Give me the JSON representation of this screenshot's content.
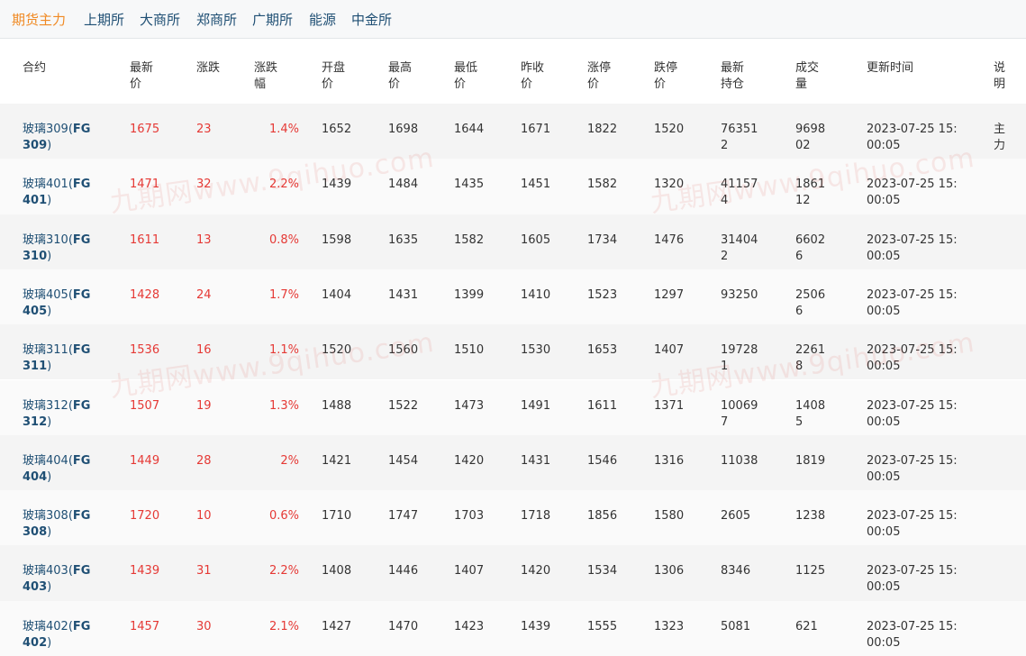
{
  "tabs": [
    {
      "label": "期货主力",
      "active": true
    },
    {
      "label": "上期所",
      "active": false
    },
    {
      "label": "大商所",
      "active": false
    },
    {
      "label": "郑商所",
      "active": false
    },
    {
      "label": "广期所",
      "active": false
    },
    {
      "label": "能源",
      "active": false
    },
    {
      "label": "中金所",
      "active": false
    }
  ],
  "table": {
    "headers": [
      "合约",
      "最新价",
      "涨跌",
      "涨跌幅",
      "开盘价",
      "最高价",
      "最低价",
      "昨收价",
      "涨停价",
      "跌停价",
      "最新持仓",
      "成交量",
      "更新时间",
      "说明"
    ],
    "rows": [
      {
        "name": "玻璃309(",
        "code": "FG",
        "code2": "309",
        ")": ")",
        "last": "1675",
        "chg": "23",
        "pct": "1.4%",
        "open": "1652",
        "high": "1698",
        "low": "1644",
        "prev": "1671",
        "up": "1822",
        "down": "1520",
        "oi": "763512",
        "vol": "969802",
        "time": "2023-07-25 15:00:05",
        "note": "主力"
      },
      {
        "name": "玻璃401(",
        "code": "FG",
        "code2": "401",
        "last": "1471",
        "chg": "32",
        "pct": "2.2%",
        "open": "1439",
        "high": "1484",
        "low": "1435",
        "prev": "1451",
        "up": "1582",
        "down": "1320",
        "oi": "411574",
        "vol": "186112",
        "time": "2023-07-25 15:00:05",
        "note": ""
      },
      {
        "name": "玻璃310(",
        "code": "FG",
        "code2": "310",
        "last": "1611",
        "chg": "13",
        "pct": "0.8%",
        "open": "1598",
        "high": "1635",
        "low": "1582",
        "prev": "1605",
        "up": "1734",
        "down": "1476",
        "oi": "314042",
        "vol": "66026",
        "time": "2023-07-25 15:00:05",
        "note": ""
      },
      {
        "name": "玻璃405(",
        "code": "FG",
        "code2": "405",
        "last": "1428",
        "chg": "24",
        "pct": "1.7%",
        "open": "1404",
        "high": "1431",
        "low": "1399",
        "prev": "1410",
        "up": "1523",
        "down": "1297",
        "oi": "93250",
        "vol": "25066",
        "time": "2023-07-25 15:00:05",
        "note": ""
      },
      {
        "name": "玻璃311(",
        "code": "FG",
        "code2": "311",
        "last": "1536",
        "chg": "16",
        "pct": "1.1%",
        "open": "1520",
        "high": "1560",
        "low": "1510",
        "prev": "1530",
        "up": "1653",
        "down": "1407",
        "oi": "197281",
        "vol": "22618",
        "time": "2023-07-25 15:00:05",
        "note": ""
      },
      {
        "name": "玻璃312(",
        "code": "FG",
        "code2": "312",
        "last": "1507",
        "chg": "19",
        "pct": "1.3%",
        "open": "1488",
        "high": "1522",
        "low": "1473",
        "prev": "1491",
        "up": "1611",
        "down": "1371",
        "oi": "100697",
        "vol": "14085",
        "time": "2023-07-25 15:00:05",
        "note": ""
      },
      {
        "name": "玻璃404(",
        "code": "FG",
        "code2": "404",
        "last": "1449",
        "chg": "28",
        "pct": "2%",
        "open": "1421",
        "high": "1454",
        "low": "1420",
        "prev": "1431",
        "up": "1546",
        "down": "1316",
        "oi": "11038",
        "vol": "1819",
        "time": "2023-07-25 15:00:05",
        "note": ""
      },
      {
        "name": "玻璃308(",
        "code": "FG",
        "code2": "308",
        "last": "1720",
        "chg": "10",
        "pct": "0.6%",
        "open": "1710",
        "high": "1747",
        "low": "1703",
        "prev": "1718",
        "up": "1856",
        "down": "1580",
        "oi": "2605",
        "vol": "1238",
        "time": "2023-07-25 15:00:05",
        "note": ""
      },
      {
        "name": "玻璃403(",
        "code": "FG",
        "code2": "403",
        "last": "1439",
        "chg": "31",
        "pct": "2.2%",
        "open": "1408",
        "high": "1446",
        "low": "1407",
        "prev": "1420",
        "up": "1534",
        "down": "1306",
        "oi": "8346",
        "vol": "1125",
        "time": "2023-07-25 15:00:05",
        "note": ""
      },
      {
        "name": "玻璃402(",
        "code": "FG",
        "code2": "402",
        "last": "1457",
        "chg": "30",
        "pct": "2.1%",
        "open": "1427",
        "high": "1470",
        "low": "1423",
        "prev": "1439",
        "up": "1555",
        "down": "1323",
        "oi": "5081",
        "vol": "621",
        "time": "2023-07-25 15:00:05",
        "note": ""
      }
    ]
  },
  "watermarks": [
    "九期网www.9qihuo.com",
    "九期网www.9qihuo.com",
    "九期网www.9qihuo.com",
    "九期网www.9qihuo.com"
  ]
}
